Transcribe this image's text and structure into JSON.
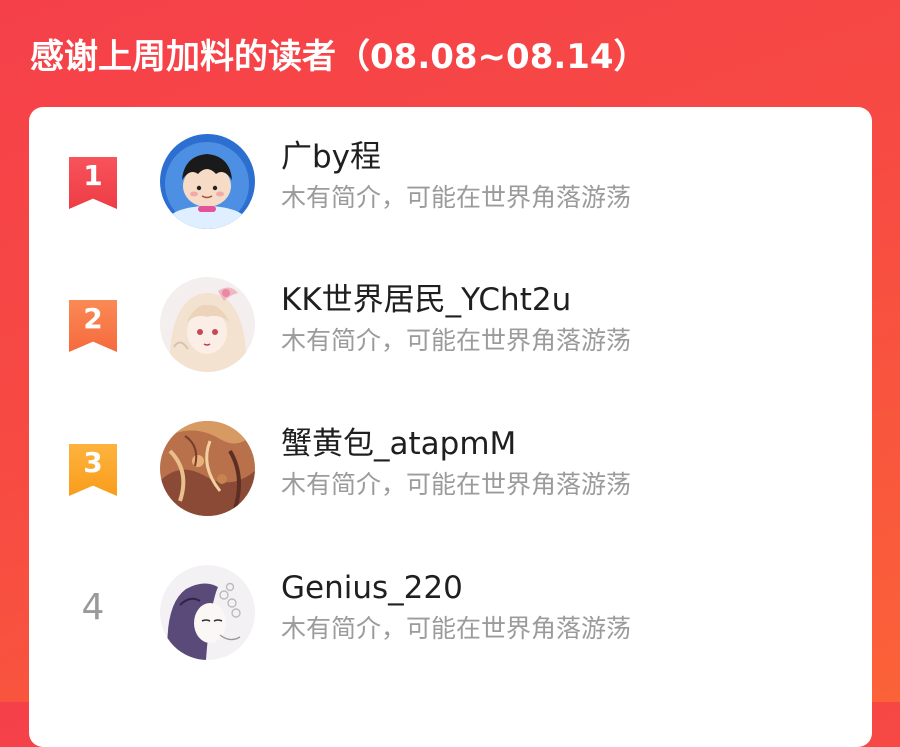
{
  "header": {
    "title": "感谢上周加料的读者（08.08~08.14）"
  },
  "readers": [
    {
      "rank": "1",
      "name": "广by程",
      "bio": "木有简介，可能在世界角落游荡",
      "badge_color": "#f2444c",
      "avatar_icon": "cartoon-boy-avatar"
    },
    {
      "rank": "2",
      "name": "KK世界居民_YCht2u",
      "bio": "木有简介，可能在世界角落游荡",
      "badge_color": "#f8774a",
      "avatar_icon": "anime-girl-avatar"
    },
    {
      "rank": "3",
      "name": "蟹黄包_atapmM",
      "bio": "木有简介，可能在世界角落游荡",
      "badge_color": "#fca52d",
      "avatar_icon": "abstract-art-avatar"
    },
    {
      "rank": "4",
      "name": "Genius_220",
      "bio": "木有简介，可能在世界角落游荡",
      "badge_color": "#9a9a9a",
      "avatar_icon": "anime-sketch-avatar"
    }
  ]
}
